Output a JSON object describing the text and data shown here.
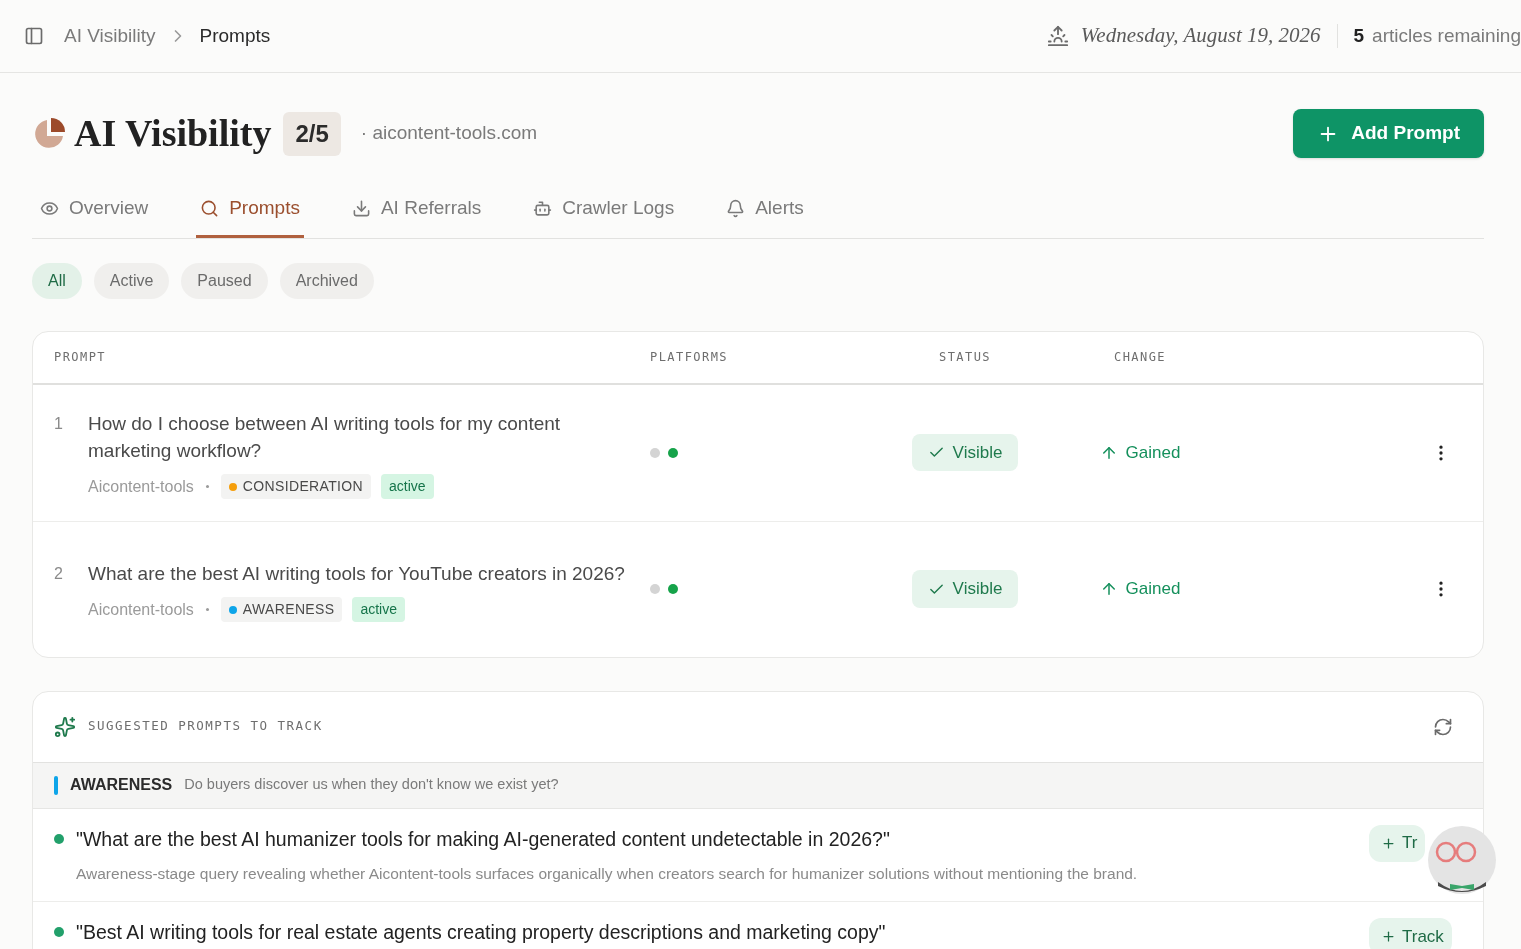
{
  "breadcrumb": [
    "AI Visibility",
    "Prompts"
  ],
  "header": {
    "date": "Wednesday, August 19, 2026",
    "articles_count": "5",
    "articles_label": "articles remaining"
  },
  "page": {
    "title": "AI Visibility",
    "count": "2/5",
    "domain": "· aicontent-tools.com",
    "add_button": "Add Prompt"
  },
  "tabs": [
    {
      "label": "Overview",
      "selected": false
    },
    {
      "label": "Prompts",
      "selected": true
    },
    {
      "label": "AI Referrals",
      "selected": false
    },
    {
      "label": "Crawler Logs",
      "selected": false
    },
    {
      "label": "Alerts",
      "selected": false
    }
  ],
  "filters": [
    {
      "label": "All",
      "selected": true
    },
    {
      "label": "Active",
      "selected": false
    },
    {
      "label": "Paused",
      "selected": false
    },
    {
      "label": "Archived",
      "selected": false
    }
  ],
  "table": {
    "columns": [
      "PROMPT",
      "PLATFORMS",
      "STATUS",
      "CHANGE"
    ],
    "rows": [
      {
        "index": "1",
        "prompt": "How do I choose between AI writing tools for my content marketing workflow?",
        "brand": "Aicontent-tools",
        "stage": {
          "label": "CONSIDERATION",
          "color": "#f59e0b"
        },
        "tag": "active",
        "platforms": [
          {
            "color": "#d4d4d4"
          },
          {
            "color": "#16a34a"
          }
        ],
        "status": {
          "label": "Visible",
          "kind": "visible"
        },
        "change": {
          "label": "Gained",
          "kind": "gained"
        }
      },
      {
        "index": "2",
        "prompt": "What are the best AI writing tools for YouTube creators in 2026?",
        "brand": "Aicontent-tools",
        "stage": {
          "label": "AWARENESS",
          "color": "#0ea5e9"
        },
        "tag": "active",
        "platforms": [
          {
            "color": "#d4d4d4"
          },
          {
            "color": "#16a34a"
          }
        ],
        "status": {
          "label": "Visible",
          "kind": "visible"
        },
        "change": {
          "label": "Gained",
          "kind": "gained"
        }
      }
    ]
  },
  "suggestions": {
    "title": "SUGGESTED PROMPTS TO TRACK",
    "group": {
      "name": "AWARENESS",
      "question": "Do buyers discover us when they don't know we exist yet?",
      "color": "#0ea5e9"
    },
    "items": [
      {
        "prompt": "\"What are the best AI humanizer tools for making AI-generated content undetectable in 2026?\"",
        "description": "Awareness-stage query revealing whether Aicontent-tools surfaces organically when creators search for humanizer solutions without mentioning the brand.",
        "button": "Tr"
      },
      {
        "prompt": "\"Best AI writing tools for real estate agents creating property descriptions and marketing copy\"",
        "button": "Track"
      }
    ]
  }
}
